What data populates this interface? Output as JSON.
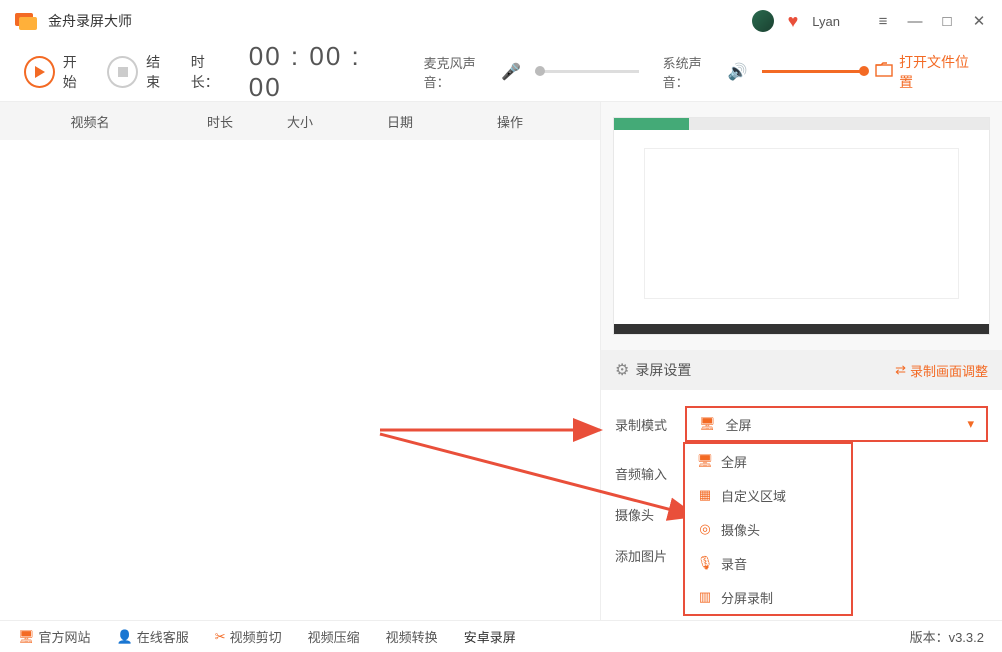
{
  "titlebar": {
    "app_name": "金舟录屏大师",
    "user": "Lyan"
  },
  "toolbar": {
    "start": "开始",
    "stop": "结束",
    "duration_label": "时长：",
    "timer": "00 : 00 : 00",
    "mic_label": "麦克风声音：",
    "sys_label": "系统声音：",
    "open_folder": "打开文件位置"
  },
  "table": {
    "headers": {
      "name": "视频名",
      "duration": "时长",
      "size": "大小",
      "date": "日期",
      "op": "操作"
    }
  },
  "settings_bar": {
    "title": "录屏设置",
    "adjust": "录制画面调整"
  },
  "settings": {
    "mode_label": "录制模式",
    "mode_value": "全屏",
    "audio_label": "音频输入",
    "camera_label": "摄像头",
    "addimg_label": "添加图片",
    "options": {
      "fullscreen": "全屏",
      "region": "自定义区域",
      "camera": "摄像头",
      "audio": "录音",
      "split": "分屏录制"
    }
  },
  "bottom": {
    "site": "官方网站",
    "cs": "在线客服",
    "cut": "视频剪切",
    "compress": "视频压缩",
    "convert": "视频转换",
    "android": "安卓录屏",
    "version_label": "版本：",
    "version": "v3.3.2"
  }
}
